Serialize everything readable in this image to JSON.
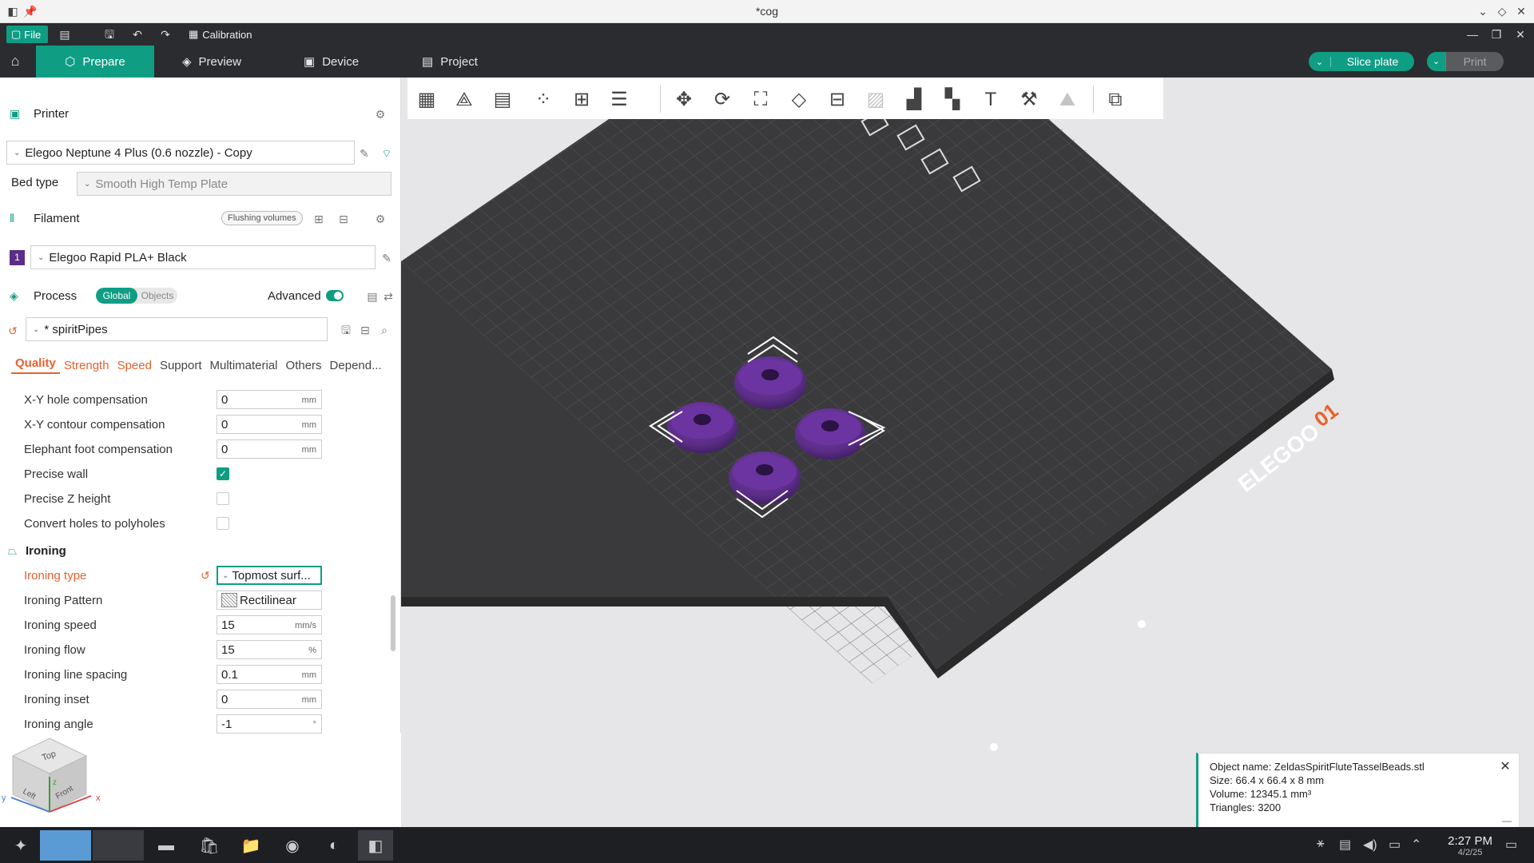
{
  "window": {
    "title": "*cog"
  },
  "menubar": {
    "file_label": "File",
    "calibration_label": "Calibration"
  },
  "tabs": {
    "prepare": "Prepare",
    "preview": "Preview",
    "device": "Device",
    "project": "Project"
  },
  "actions": {
    "slice_label": "Slice plate",
    "print_label": "Print"
  },
  "printer": {
    "section_label": "Printer",
    "selected": "Elegoo Neptune 4 Plus (0.6 nozzle) - Copy",
    "bed_type_label": "Bed type",
    "bed_type_value": "Smooth High Temp Plate"
  },
  "filament": {
    "section_label": "Filament",
    "flushing_label": "Flushing volumes",
    "slot_number": "1",
    "slot_color": "#5b2d86",
    "selected": "Elegoo Rapid PLA+ Black"
  },
  "process": {
    "section_label": "Process",
    "global_label": "Global",
    "objects_label": "Objects",
    "advanced_label": "Advanced",
    "preset": "* spiritPipes"
  },
  "settings_tabs": [
    "Quality",
    "Strength",
    "Speed",
    "Support",
    "Multimaterial",
    "Others",
    "Depend..."
  ],
  "quality_rows": [
    {
      "label": "X-Y hole compensation",
      "value": "0",
      "unit": "mm"
    },
    {
      "label": "X-Y contour compensation",
      "value": "0",
      "unit": "mm"
    },
    {
      "label": "Elephant foot compensation",
      "value": "0",
      "unit": "mm"
    }
  ],
  "checkbox_rows": [
    {
      "label": "Precise wall",
      "checked": true
    },
    {
      "label": "Precise Z height",
      "checked": false
    },
    {
      "label": "Convert holes to polyholes",
      "checked": false
    }
  ],
  "ironing": {
    "section_label": "Ironing",
    "type_label": "Ironing type",
    "type_value": "Topmost surf...",
    "pattern_label": "Ironing Pattern",
    "pattern_value": "Rectilinear",
    "rows": [
      {
        "label": "Ironing speed",
        "value": "15",
        "unit": "mm/s"
      },
      {
        "label": "Ironing flow",
        "value": "15",
        "unit": "%"
      },
      {
        "label": "Ironing line spacing",
        "value": "0.1",
        "unit": "mm"
      },
      {
        "label": "Ironing inset",
        "value": "0",
        "unit": "mm"
      },
      {
        "label": "Ironing angle",
        "value": "-1",
        "unit": "°"
      }
    ]
  },
  "bed": {
    "brand": "ELEGOO",
    "plate_number": "01"
  },
  "object_info": {
    "name": "Object name: ZeldasSpiritFluteTasselBeads.stl",
    "size": "Size: 66.4 x 66.4 x 8 mm",
    "volume": "Volume: 12345.1 mm³",
    "triangles": "Triangles: 3200"
  },
  "navcube": {
    "top": "Top",
    "left": "Left",
    "front": "Front",
    "x": "x",
    "y": "y",
    "z": "z"
  },
  "taskbar": {
    "time": "2:27 PM",
    "date": "4/2/25"
  },
  "colors": {
    "accent": "#0f9d84",
    "modified": "#e8612c",
    "model": "#5b2d86",
    "bed": "#3a3a3c"
  }
}
